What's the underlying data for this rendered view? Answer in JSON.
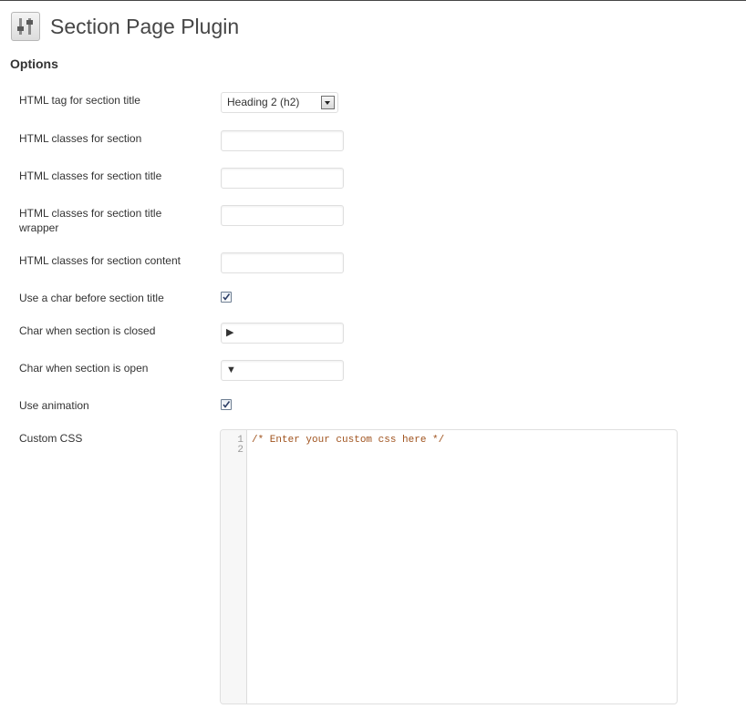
{
  "header": {
    "title": "Section Page Plugin",
    "icon": "settings-sliders-icon"
  },
  "options": {
    "heading": "Options",
    "rows": {
      "html_tag": {
        "label": "HTML tag for section title",
        "selected": "Heading 2 (h2)"
      },
      "classes_section": {
        "label": "HTML classes for section",
        "value": ""
      },
      "classes_section_title": {
        "label": "HTML classes for section title",
        "value": ""
      },
      "classes_title_wrapper": {
        "label": "HTML classes for section title wrapper",
        "value": ""
      },
      "classes_section_content": {
        "label": "HTML classes for section content",
        "value": ""
      },
      "use_char": {
        "label": "Use a char before section title",
        "checked": true
      },
      "char_closed": {
        "label": "Char when section is closed",
        "value": "▶"
      },
      "char_open": {
        "label": "Char when section is open",
        "value": "▼"
      },
      "use_animation": {
        "label": "Use animation",
        "checked": true
      },
      "custom_css": {
        "label": "Custom CSS",
        "line_numbers": [
          "1",
          "2"
        ],
        "code": "/* Enter your custom css here */"
      }
    }
  },
  "colors": {
    "title_text": "#464646",
    "code_comment": "#a0531e",
    "checkbox_check": "#2c3e66"
  }
}
